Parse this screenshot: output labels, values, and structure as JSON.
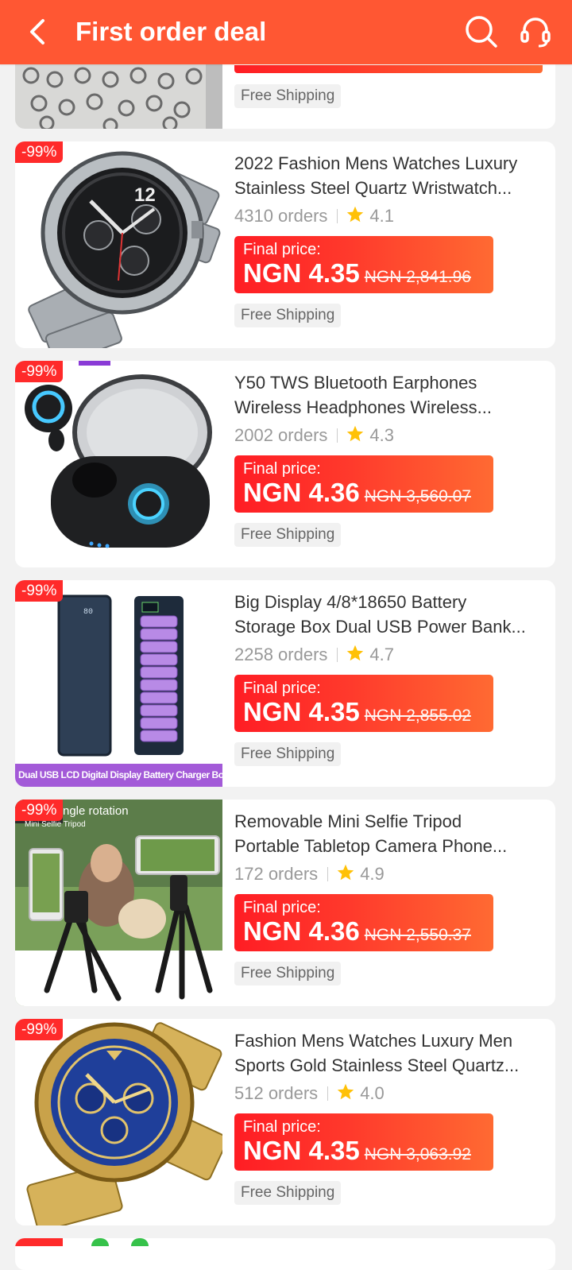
{
  "header": {
    "title": "First order deal",
    "back_icon": "back-arrow-icon",
    "search_icon": "search-icon",
    "support_icon": "headset-icon",
    "color": "#ff5733"
  },
  "labels": {
    "final_price": "Final price:",
    "free_shipping": "Free Shipping"
  },
  "products": [
    {
      "discount": "-99%",
      "title_line1": "2022 Fashion Mens Watches Luxury",
      "title_line2": "Stainless Steel Quartz Wristwatch...",
      "orders": "4310 orders",
      "rating": "4.1",
      "price": "NGN 4.35",
      "original_price": "NGN 2,841.96",
      "shipping": "Free Shipping"
    },
    {
      "discount": "-99%",
      "title_line1": "Y50 TWS Bluetooth Earphones",
      "title_line2": "Wireless Headphones Wireless...",
      "orders": "2002 orders",
      "rating": "4.3",
      "price": "NGN 4.36",
      "original_price": "NGN 3,560.07",
      "shipping": "Free Shipping"
    },
    {
      "discount": "-99%",
      "title_line1": "Big Display 4/8*18650 Battery",
      "title_line2": "Storage Box Dual USB Power Bank...",
      "orders": "2258 orders",
      "rating": "4.7",
      "price": "NGN 4.35",
      "original_price": "NGN 2,855.02",
      "shipping": "Free Shipping",
      "image_caption": "Dual USB LCD Digital Display Battery Charger Box"
    },
    {
      "discount": "-99%",
      "title_line1": "Removable Mini Selfie Tripod",
      "title_line2": "Portable Tabletop Camera Phone...",
      "orders": "172 orders",
      "rating": "4.9",
      "price": "NGN 4.36",
      "original_price": "NGN 2,550.37",
      "shipping": "Free Shipping",
      "image_caption": "ngle rotation",
      "image_subcaption": "Mini Selfie Tripod"
    },
    {
      "discount": "-99%",
      "title_line1": "Fashion Mens Watches Luxury Men",
      "title_line2": "Sports Gold Stainless Steel Quartz...",
      "orders": "512 orders",
      "rating": "4.0",
      "price": "NGN 4.35",
      "original_price": "NGN 3,063.92",
      "shipping": "Free Shipping"
    }
  ],
  "top_partial": {
    "shipping": "Free Shipping"
  },
  "colors": {
    "accent": "#ff5733",
    "price_start": "#ff1d24",
    "price_end": "#ff6a32",
    "star": "#ffc107"
  }
}
